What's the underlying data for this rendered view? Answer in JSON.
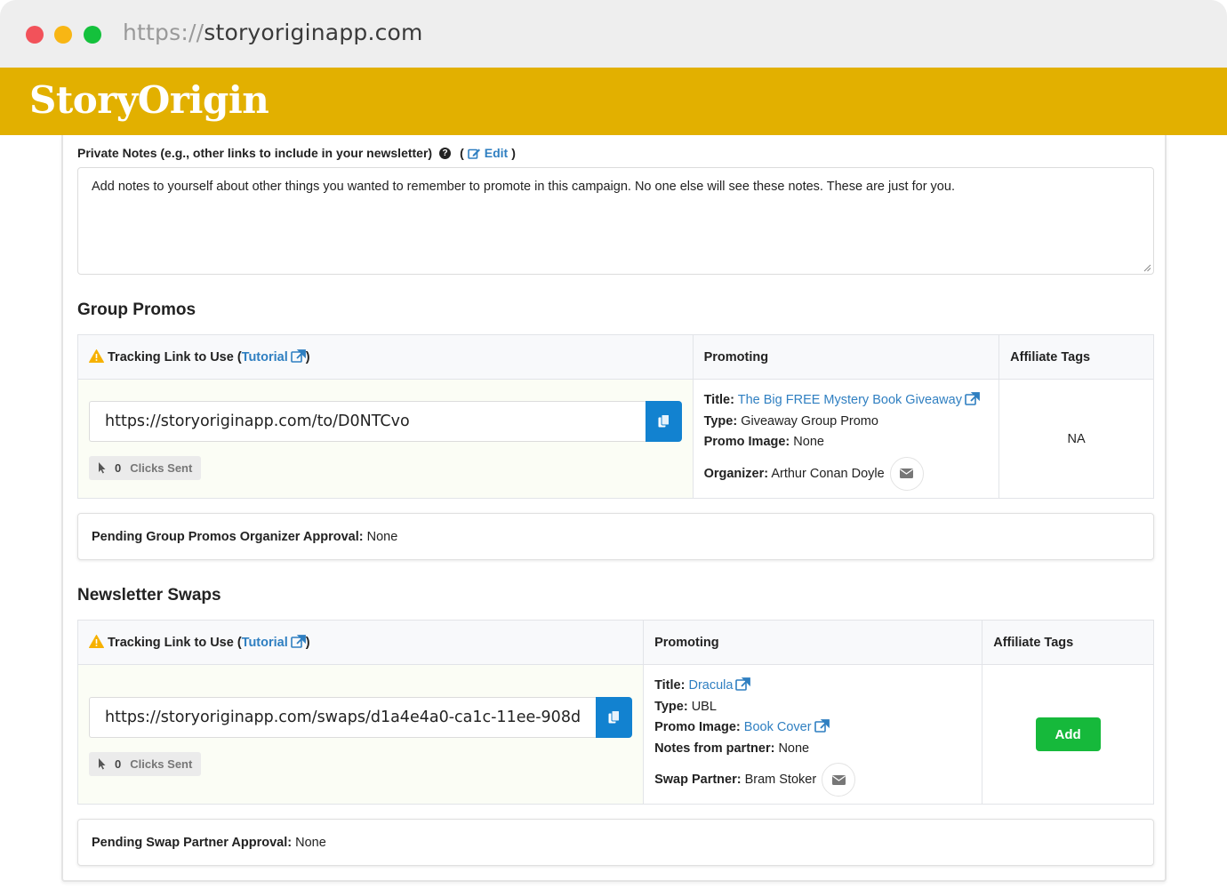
{
  "browser": {
    "url_protocol": "https://",
    "url_host": "storyoriginapp.com"
  },
  "brand": {
    "name": "StoryOrigin",
    "color": "#e2b000"
  },
  "private_notes": {
    "label": "Private Notes (e.g., other links to include in your newsletter)",
    "edit_label": "Edit",
    "text": "Add notes to yourself about other things you wanted to remember to promote in this campaign. No one else will see these notes. These are just for you."
  },
  "group_promos": {
    "title": "Group Promos",
    "columns": {
      "tracking_prefix": "Tracking Link to Use (",
      "tutorial": "Tutorial",
      "tracking_suffix": ")",
      "promoting": "Promoting",
      "affiliate_tags": "Affiliate Tags"
    },
    "tracking_url": "https://storyoriginapp.com/to/D0NTCvo",
    "clicks_count": "0",
    "clicks_label": "Clicks Sent",
    "promo": {
      "title_label": "Title:",
      "title_value": "The Big FREE Mystery Book Giveaway",
      "type_label": "Type:",
      "type_value": "Giveaway Group Promo",
      "image_label": "Promo Image:",
      "image_value": "None",
      "organizer_label": "Organizer:",
      "organizer_value": "Arthur Conan Doyle"
    },
    "affiliate_value": "NA",
    "pending_label": "Pending Group Promos Organizer Approval:",
    "pending_value": "None"
  },
  "newsletter_swaps": {
    "title": "Newsletter Swaps",
    "columns": {
      "tracking_prefix": "Tracking Link to Use (",
      "tutorial": "Tutorial",
      "tracking_suffix": ")",
      "promoting": "Promoting",
      "affiliate_tags": "Affiliate Tags"
    },
    "tracking_url": "https://storyoriginapp.com/swaps/d1a4e4a0-ca1c-11ee-908d",
    "clicks_count": "0",
    "clicks_label": "Clicks Sent",
    "promo": {
      "title_label": "Title:",
      "title_value": "Dracula",
      "type_label": "Type:",
      "type_value": "UBL",
      "image_label": "Promo Image:",
      "image_value": "Book Cover",
      "notes_label": "Notes from partner:",
      "notes_value": "None",
      "partner_label": "Swap Partner:",
      "partner_value": "Bram Stoker"
    },
    "add_button": "Add",
    "pending_label": "Pending Swap Partner Approval:",
    "pending_value": "None"
  },
  "colors": {
    "link": "#2f7fc1",
    "copy_button": "#1282d0",
    "add_button": "#16b93b",
    "warning": "#f6b100"
  }
}
